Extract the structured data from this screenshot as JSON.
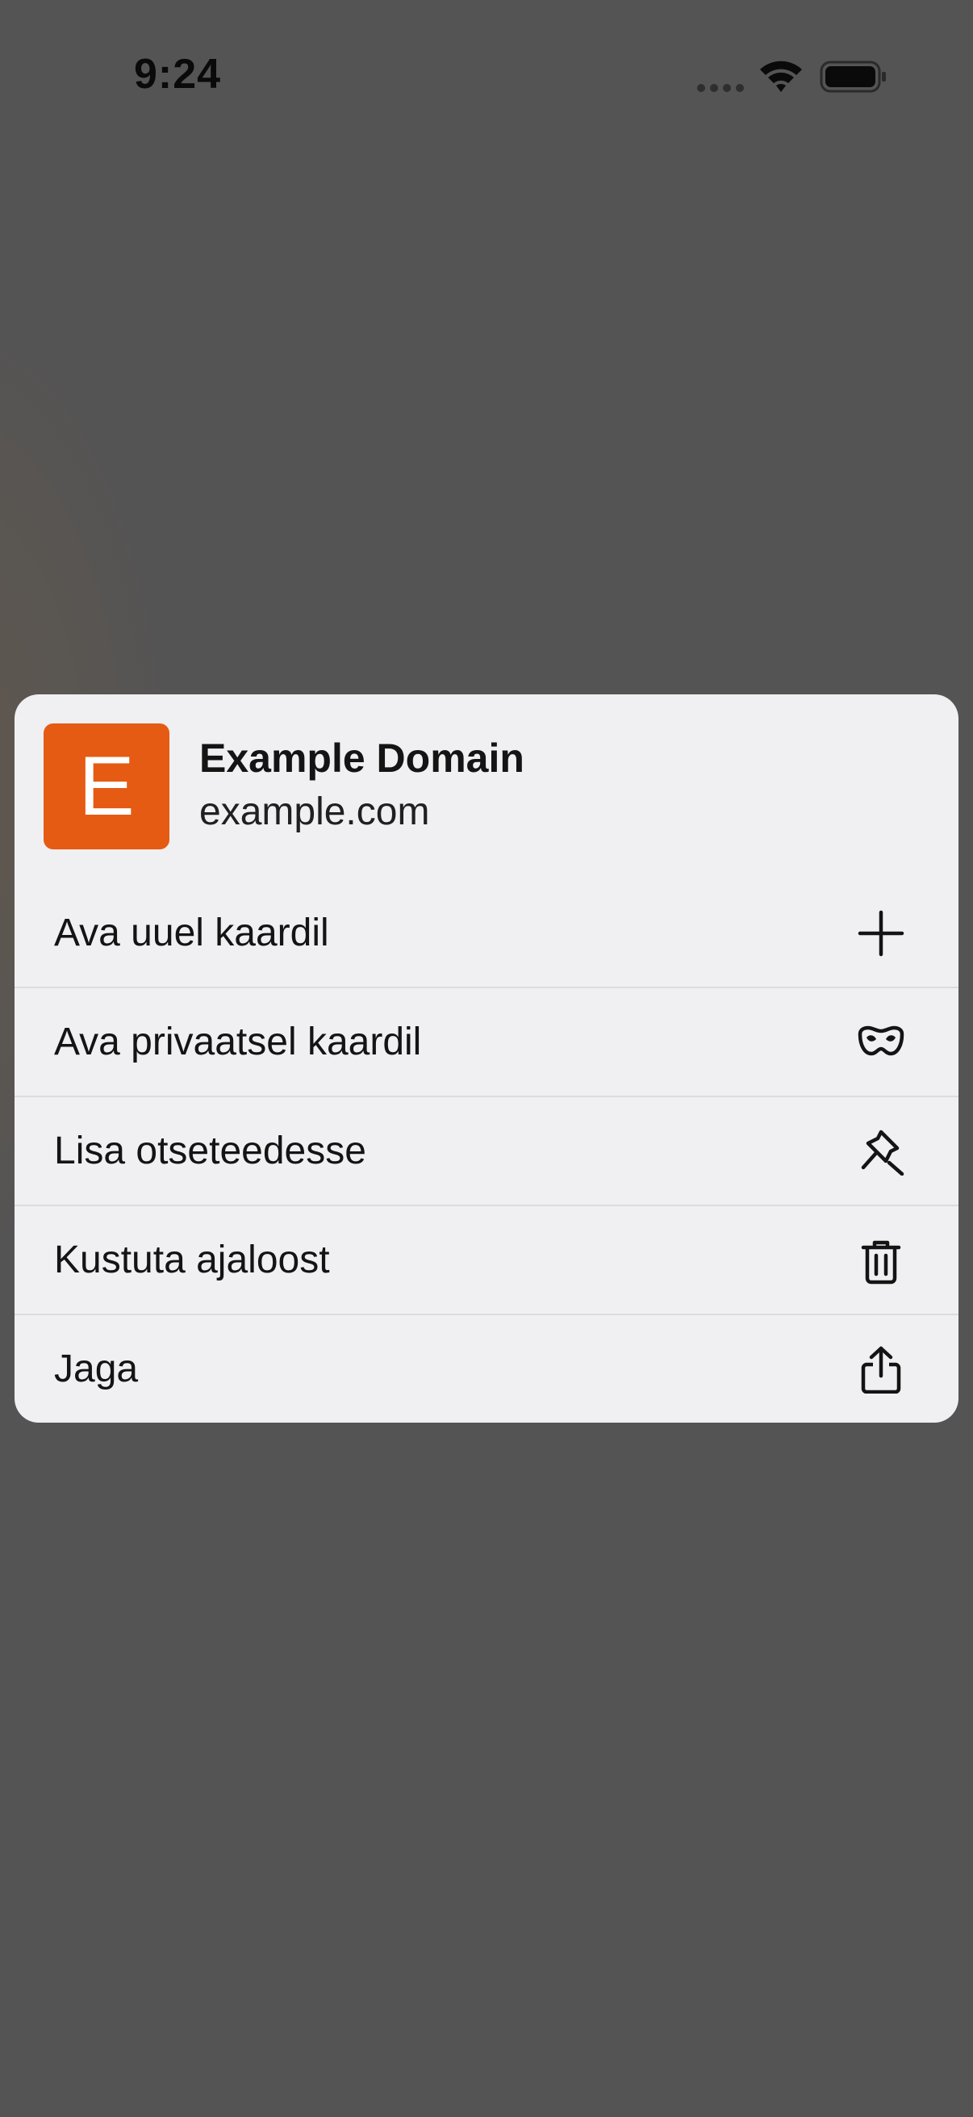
{
  "status_bar": {
    "time": "9:24"
  },
  "context_menu": {
    "site": {
      "favicon_letter": "E",
      "favicon_color": "#e55b13",
      "title": "Example Domain",
      "url": "example.com"
    },
    "items": [
      {
        "label": "Ava uuel kaardil",
        "icon": "plus-icon"
      },
      {
        "label": "Ava privaatsel kaardil",
        "icon": "private-mask-icon"
      },
      {
        "label": "Lisa otseteedesse",
        "icon": "pin-icon"
      },
      {
        "label": "Kustuta ajaloost",
        "icon": "trash-icon"
      },
      {
        "label": "Jaga",
        "icon": "share-icon"
      }
    ]
  }
}
